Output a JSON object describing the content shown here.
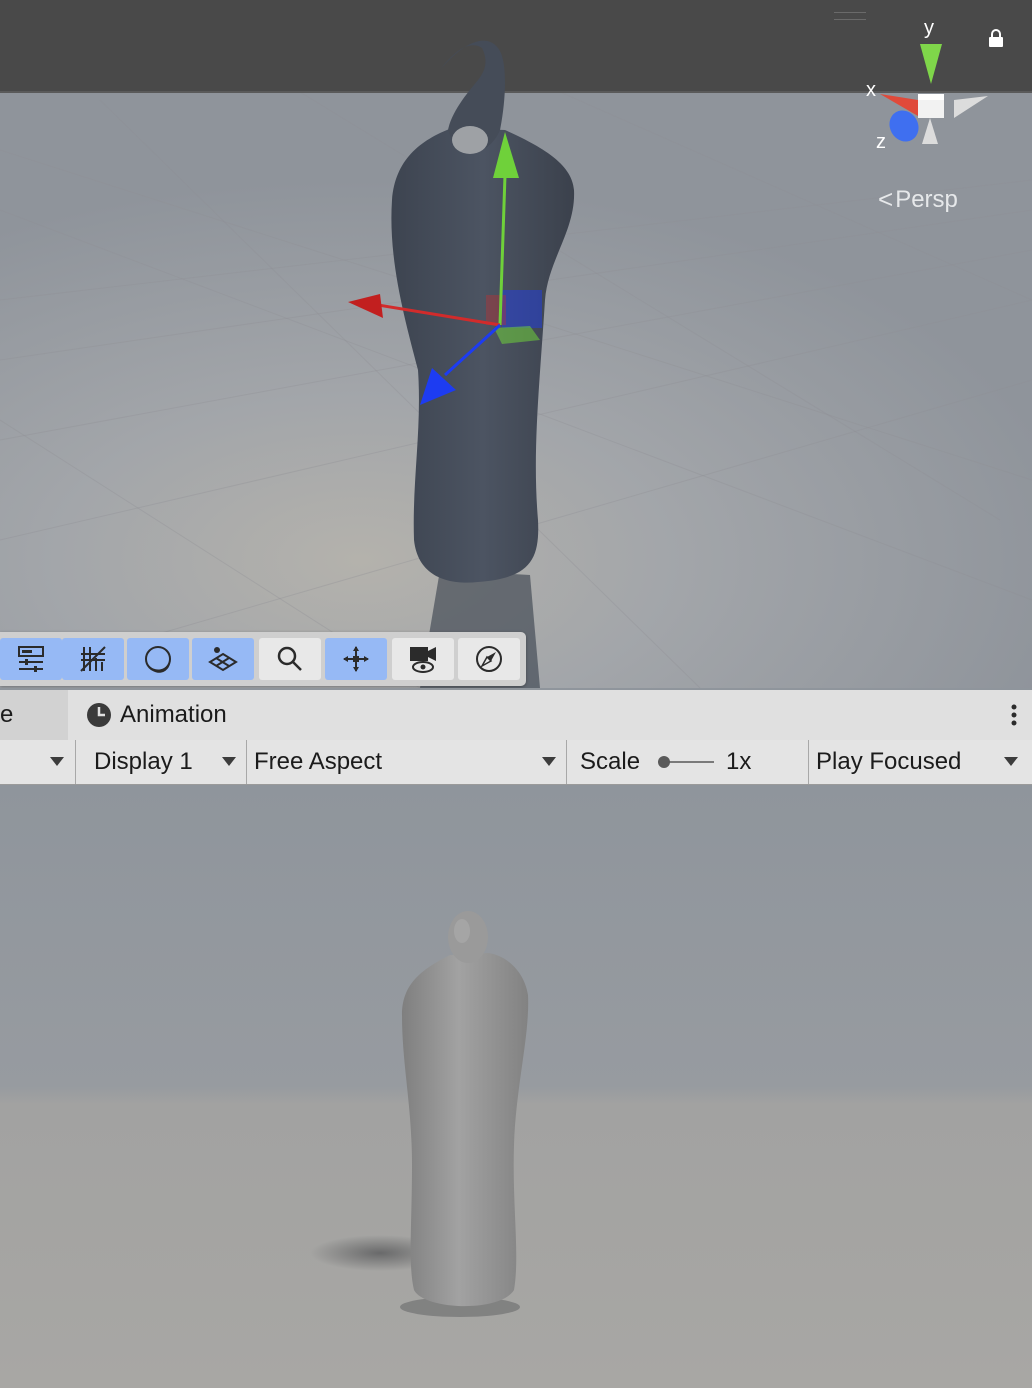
{
  "scene_view": {
    "projection_label": "Persp",
    "gizmo_axes": {
      "x": "x",
      "y": "y",
      "z": "z"
    },
    "icons": [
      "drag-handle",
      "lock-icon",
      "orientation-gizmo"
    ],
    "overlay_toolbar": [
      {
        "name": "tool-settings-icon",
        "active": true
      },
      {
        "name": "grid-snapping-icon",
        "active": true
      },
      {
        "name": "shading-mode-icon",
        "active": true
      },
      {
        "name": "grid-visibility-icon",
        "active": true
      },
      {
        "name": "search-icon",
        "active": false
      },
      {
        "name": "gizmos-icon",
        "active": true
      },
      {
        "name": "scene-camera-icon",
        "active": false
      },
      {
        "name": "compass-icon",
        "active": false
      }
    ]
  },
  "tabs": {
    "previous_tab_fragment": "e",
    "animation_label": "Animation"
  },
  "game_toolbar": {
    "display": "Display 1",
    "aspect": "Free Aspect",
    "scale_label": "Scale",
    "scale_value": "1x",
    "scale_slider_fraction": 0.0,
    "play_mode": "Play Focused"
  },
  "colors": {
    "active_tool": "#96b9f5",
    "axis_x": "#d22b2b",
    "axis_y": "#6fd13a",
    "axis_z": "#1d3cf2"
  }
}
